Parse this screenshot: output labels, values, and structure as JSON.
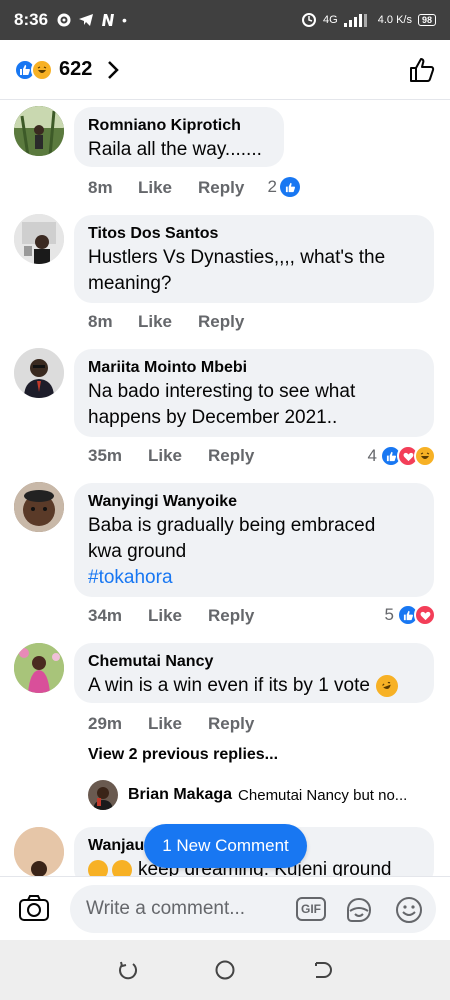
{
  "status_bar": {
    "time": "8:36",
    "network": "4G",
    "speed": "4.0 K/s",
    "battery": "98"
  },
  "header": {
    "reaction_count": "622"
  },
  "comments": [
    {
      "name": "Romniano Kiprotich",
      "text": "Raila all the way.......",
      "time": "8m",
      "like": "Like",
      "reply": "Reply",
      "reaction_count": "2"
    },
    {
      "name": "Titos Dos Santos",
      "text1": "Hustlers Vs Dynasties,,,, what's the",
      "text2": "meaning?",
      "time": "8m",
      "like": "Like",
      "reply": "Reply"
    },
    {
      "name": "Mariita Mointo Mbebi",
      "text1": "Na bado interesting to see what",
      "text2": "happens by December 2021..",
      "time": "35m",
      "like": "Like",
      "reply": "Reply",
      "reaction_count": "4"
    },
    {
      "name": "Wanyingi Wanyoike",
      "text1": "Baba is gradually being embraced",
      "text2": "kwa ground",
      "hashtag": "#tokahora",
      "time": "34m",
      "like": "Like",
      "reply": "Reply",
      "reaction_count": "5"
    },
    {
      "name": "Chemutai Nancy",
      "text": "A win is a win even if its by 1 vote",
      "time": "29m",
      "like": "Like",
      "reply": "Reply"
    },
    {
      "name": "Wanjau",
      "text": "keep dreaming. Kujeni ground"
    }
  ],
  "view_previous": "View 2 previous replies...",
  "reply_preview": {
    "name": "Brian Makaga",
    "text": "Chemutai Nancy but no..."
  },
  "new_comment_pill": "1 New Comment",
  "composer": {
    "placeholder": "Write a comment...",
    "gif_label": "GIF"
  },
  "colors": {
    "facebook_blue": "#1877f2",
    "bubble_gray": "#f0f2f5",
    "meta_gray": "#65676b",
    "love_red": "#f33e58",
    "haha_yellow": "#f7b125"
  },
  "icons": [
    "settings-icon",
    "telegram-icon",
    "n-icon",
    "like-reaction-icon",
    "haha-reaction-icon",
    "love-reaction-icon",
    "chevron-right-icon",
    "thumbs-up-icon",
    "camera-icon",
    "gif-icon",
    "sticker-icon",
    "emoji-icon",
    "back-nav-icon",
    "home-nav-icon",
    "recents-nav-icon"
  ]
}
